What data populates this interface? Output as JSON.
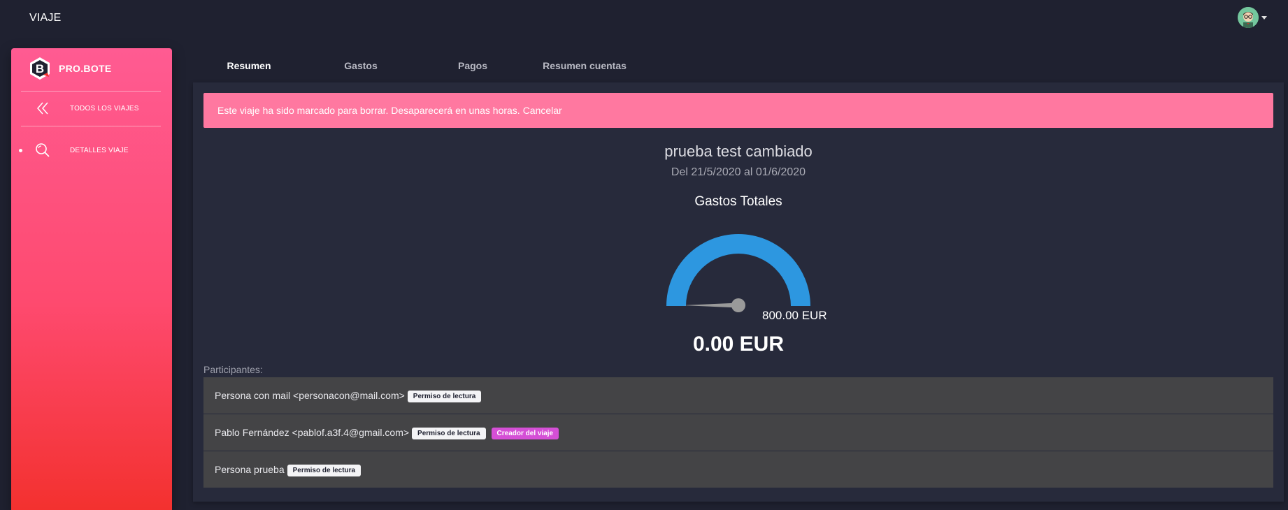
{
  "header": {
    "title": "VIAJE",
    "avatar_icon": "user-avatar-icon"
  },
  "sidebar": {
    "brand": "PRO.BOTE",
    "items": [
      {
        "label": "TODOS LOS VIAJES",
        "icon": "double-chevron-left-icon"
      },
      {
        "label": "DETALLES VIAJE",
        "icon": "search-icon",
        "active": true
      }
    ],
    "colors": {
      "top": "#ff5b92",
      "bottom": "#f3312f"
    }
  },
  "tabs": [
    {
      "label": "Resumen",
      "active": true
    },
    {
      "label": "Gastos"
    },
    {
      "label": "Pagos"
    },
    {
      "label": "Resumen cuentas"
    }
  ],
  "alert": {
    "text": "Este viaje ha sido marcado para borrar. Desaparecerá en unas horas.",
    "link": "Cancelar",
    "color": "#ff78a0"
  },
  "trip": {
    "name": "prueba test cambiado",
    "dates": "Del 21/5/2020 al 01/6/2020"
  },
  "gauge": {
    "title": "Gastos Totales",
    "max_label": "800.00 EUR",
    "value_label": "0.00 EUR",
    "value": 0,
    "max": 800,
    "color": "#2d97e0"
  },
  "participants": {
    "label": "Participantes:",
    "items": [
      {
        "name": "Persona con mail <personacon@mail.com>",
        "badges": [
          "Permiso de lectura"
        ]
      },
      {
        "name": "Pablo Fernández <pablof.a3f.4@gmail.com>",
        "badges": [
          "Permiso de lectura",
          "Creador del viaje"
        ]
      },
      {
        "name": "Persona prueba",
        "badges": [
          "Permiso de lectura"
        ]
      }
    ]
  }
}
